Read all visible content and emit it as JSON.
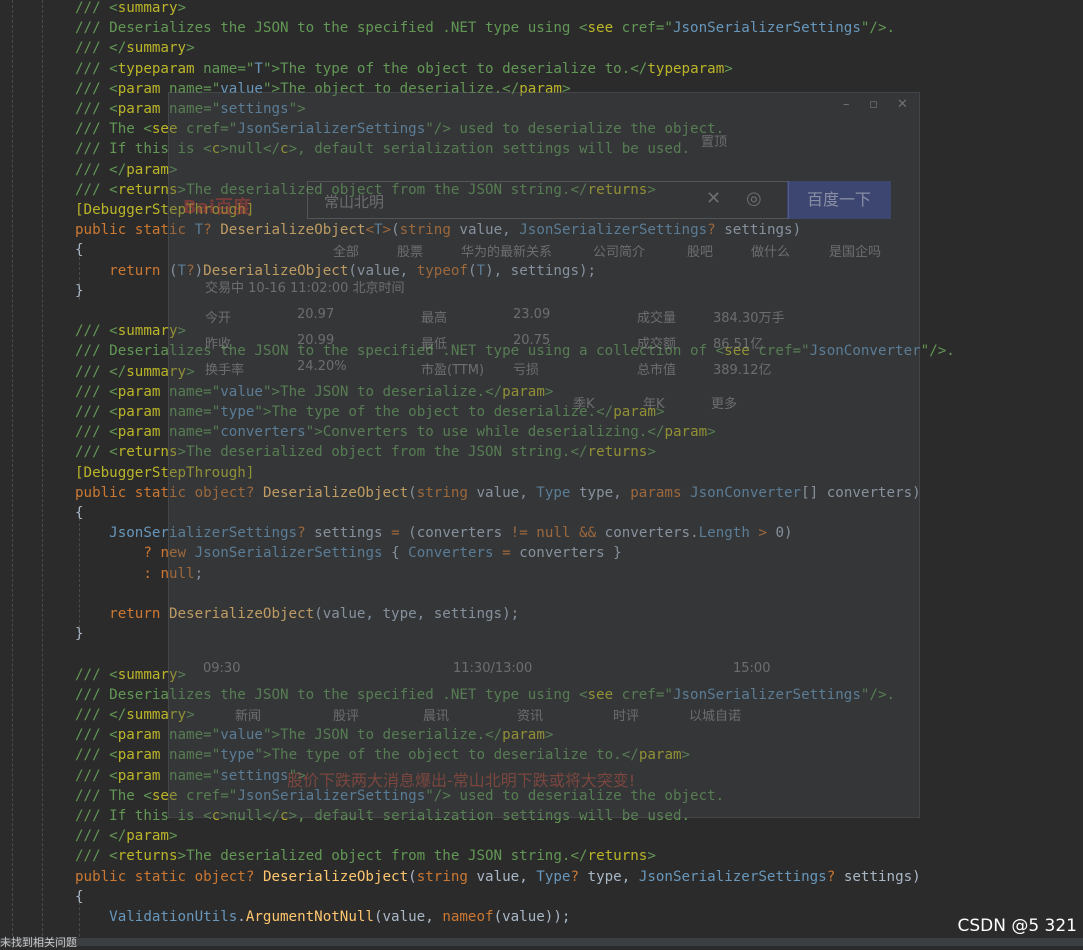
{
  "code": {
    "lines": [
      "/// <summary>",
      "/// Deserializes the JSON to the specified .NET type using <see cref=\"JsonSerializerSettings\"/>.",
      "/// </summary>",
      "/// <typeparam name=\"T\">The type of the object to deserialize to.</typeparam>",
      "/// <param name=\"value\">The object to deserialize.</param>",
      "/// <param name=\"settings\">",
      "/// The <see cref=\"JsonSerializerSettings\"/> used to deserialize the object.",
      "/// If this is <c>null</c>, default serialization settings will be used.",
      "/// </param>",
      "/// <returns>The deserialized object from the JSON string.</returns>",
      "[DebuggerStepThrough]",
      "public static T? DeserializeObject<T>(string value, JsonSerializerSettings? settings)",
      "{",
      "    return (T?)DeserializeObject(value, typeof(T), settings);",
      "}",
      "",
      "/// <summary>",
      "/// Deserializes the JSON to the specified .NET type using a collection of <see cref=\"JsonConverter\"/>.",
      "/// </summary>",
      "/// <param name=\"value\">The JSON to deserialize.</param>",
      "/// <param name=\"type\">The type of the object to deserialize.</param>",
      "/// <param name=\"converters\">Converters to use while deserializing.</param>",
      "/// <returns>The deserialized object from the JSON string.</returns>",
      "[DebuggerStepThrough]",
      "public static object? DeserializeObject(string value, Type type, params JsonConverter[] converters)",
      "{",
      "    JsonSerializerSettings? settings = (converters != null && converters.Length > 0)",
      "        ? new JsonSerializerSettings { Converters = converters }",
      "        : null;",
      "",
      "    return DeserializeObject(value, type, settings);",
      "}",
      "",
      "/// <summary>",
      "/// Deserializes the JSON to the specified .NET type using <see cref=\"JsonSerializerSettings\"/>.",
      "/// </summary>",
      "/// <param name=\"value\">The JSON to deserialize.</param>",
      "/// <param name=\"type\">The type of the object to deserialize to.</param>",
      "/// <param name=\"settings\">",
      "/// The <see cref=\"JsonSerializerSettings\"/> used to deserialize the object.",
      "/// If this is <c>null</c>, default serialization settings will be used.",
      "/// </param>",
      "/// <returns>The deserialized object from the JSON string.</returns>",
      "public static object? DeserializeObject(string value, Type? type, JsonSerializerSettings? settings)",
      "{",
      "    ValidationUtils.ArgumentNotNull(value, nameof(value));"
    ]
  },
  "overlay": {
    "pin_label": "置顶",
    "logo": "Bai百度",
    "search_value": "常山北明",
    "search_button": "百度一下",
    "tabs": [
      "全部",
      "股票",
      "华为的最新关系",
      "公司简介",
      "股吧",
      "做什么",
      "是国企吗"
    ],
    "trade_time": "交易中 10-16 11:02:00 北京时间",
    "stats": [
      [
        "今开",
        "20.97",
        "最高",
        "23.09",
        "成交量",
        "384.30万手"
      ],
      [
        "昨收",
        "20.99",
        "最低",
        "20.75",
        "成交额",
        "86.51亿"
      ],
      [
        "换手率",
        "24.20%",
        "市盈(TTM)",
        "亏损",
        "总市值",
        "389.12亿"
      ]
    ],
    "periods": [
      "季K",
      "年K",
      "更多"
    ],
    "axis_times": [
      "09:30",
      "11:30/13:00",
      "15:00"
    ],
    "bottom_tabs": [
      "新闻",
      "股评",
      "晨讯",
      "资讯",
      "时评",
      "以城自诺"
    ],
    "headline": "股价下跌两大消息爆出-常山北明下跌或将大突变!"
  },
  "status": {
    "left_text": "未找到相关问题",
    "watermark": "CSDN @5 321"
  },
  "colors": {
    "background": "#2b2b2b",
    "keyword": "#cc7832",
    "type": "#6897bb",
    "string": "#6a8759",
    "method": "#ffc66d",
    "doc_comment": "#629755",
    "attribute": "#bbb529",
    "identifier": "#a9b7c6"
  }
}
